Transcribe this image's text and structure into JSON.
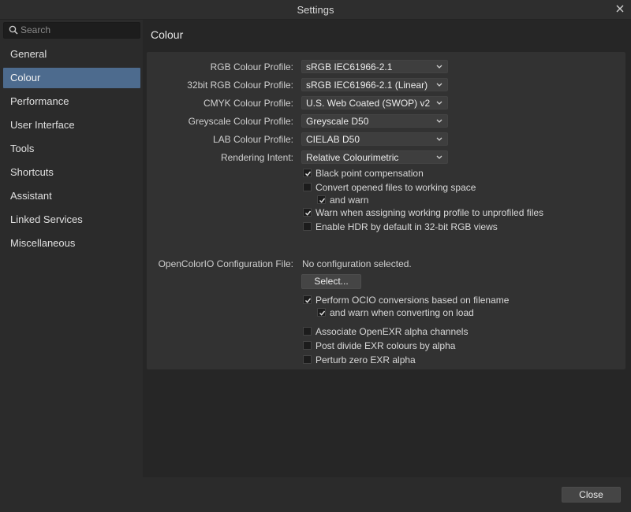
{
  "window": {
    "title": "Settings"
  },
  "search": {
    "placeholder": "Search"
  },
  "sidebar": {
    "items": [
      {
        "label": "General"
      },
      {
        "label": "Colour"
      },
      {
        "label": "Performance"
      },
      {
        "label": "User Interface"
      },
      {
        "label": "Tools"
      },
      {
        "label": "Shortcuts"
      },
      {
        "label": "Assistant"
      },
      {
        "label": "Linked Services"
      },
      {
        "label": "Miscellaneous"
      }
    ],
    "selected": "Colour"
  },
  "main": {
    "title": "Colour",
    "profiles": [
      {
        "label": "RGB Colour Profile:",
        "value": "sRGB IEC61966-2.1"
      },
      {
        "label": "32bit RGB Colour Profile:",
        "value": "sRGB IEC61966-2.1 (Linear)"
      },
      {
        "label": "CMYK Colour Profile:",
        "value": "U.S. Web Coated (SWOP) v2"
      },
      {
        "label": "Greyscale Colour Profile:",
        "value": "Greyscale D50"
      },
      {
        "label": "LAB Colour Profile:",
        "value": "CIELAB D50"
      },
      {
        "label": "Rendering Intent:",
        "value": "Relative Colourimetric"
      }
    ],
    "checks1": [
      {
        "label": "Black point compensation",
        "checked": true
      },
      {
        "label": "Convert opened files to working space",
        "checked": false
      },
      {
        "label": "and warn",
        "checked": true
      },
      {
        "label": "Warn when assigning working profile to unprofiled files",
        "checked": true
      },
      {
        "label": "Enable HDR by default in 32-bit RGB views",
        "checked": false
      }
    ],
    "ocio": {
      "label": "OpenColorIO Configuration File:",
      "value": "No configuration selected.",
      "select_button": "Select..."
    },
    "checks2": [
      {
        "label": "Perform OCIO conversions based on filename",
        "checked": true
      },
      {
        "label": "and warn when converting on load",
        "checked": true
      },
      {
        "label": "Associate OpenEXR alpha channels",
        "checked": false
      },
      {
        "label": "Post divide EXR colours by alpha",
        "checked": false
      },
      {
        "label": "Perturb zero EXR alpha",
        "checked": false
      }
    ]
  },
  "footer": {
    "close_button": "Close"
  },
  "colors": {
    "accent": "#4d6b8e"
  }
}
